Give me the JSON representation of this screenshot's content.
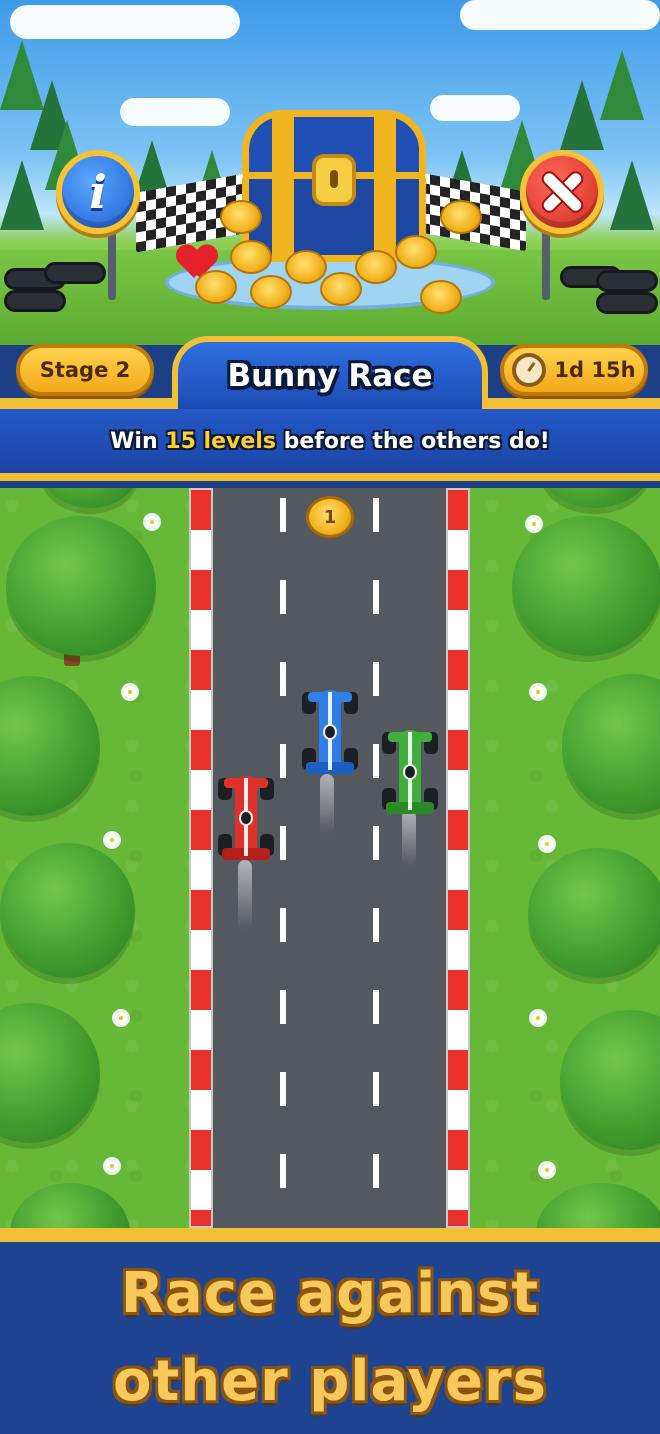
{
  "event": {
    "stage_label": "Stage 2",
    "title": "Bunny Race",
    "timer": "1d 15h",
    "instruction_prefix": "Win ",
    "instruction_highlight": "15 levels",
    "instruction_suffix": " before the others do!"
  },
  "buttons": {
    "info_icon": "info-icon",
    "close_icon": "close-icon",
    "info_glyph": "i"
  },
  "race": {
    "leader_rank": "1",
    "racers": [
      {
        "color": "red",
        "hex": "#e0302a"
      },
      {
        "color": "blue",
        "hex": "#2f7fe8"
      },
      {
        "color": "green",
        "hex": "#3fae3a"
      }
    ]
  },
  "promo": {
    "line1": "Race against",
    "line2": "other players"
  },
  "colors": {
    "gold": "#f3bf35",
    "navy": "#1e4391",
    "highlight": "#ffcf2e",
    "promo_text": "#f7c85a"
  }
}
